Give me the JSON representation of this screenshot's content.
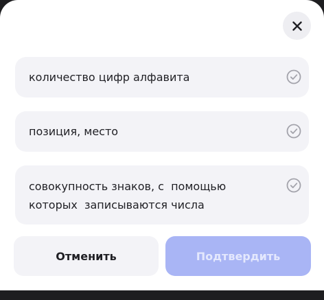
{
  "dialog": {
    "close_icon": "close-icon",
    "options": [
      {
        "text": "количество цифр алфавита",
        "icon": "check-circle-icon"
      },
      {
        "text": "позиция, место",
        "icon": "check-circle-icon"
      },
      {
        "line1": "совокупность знаков, с  помощью",
        "line2": "которых  записываются числа",
        "icon": "check-circle-icon"
      }
    ],
    "cancel_label": "Отменить",
    "confirm_label": "Подтвердить"
  },
  "colors": {
    "option_bg": "#f3f3f7",
    "confirm_disabled_bg": "#a9b5f5",
    "check_icon": "#a3a3ab",
    "backdrop": "#1e1e20"
  }
}
